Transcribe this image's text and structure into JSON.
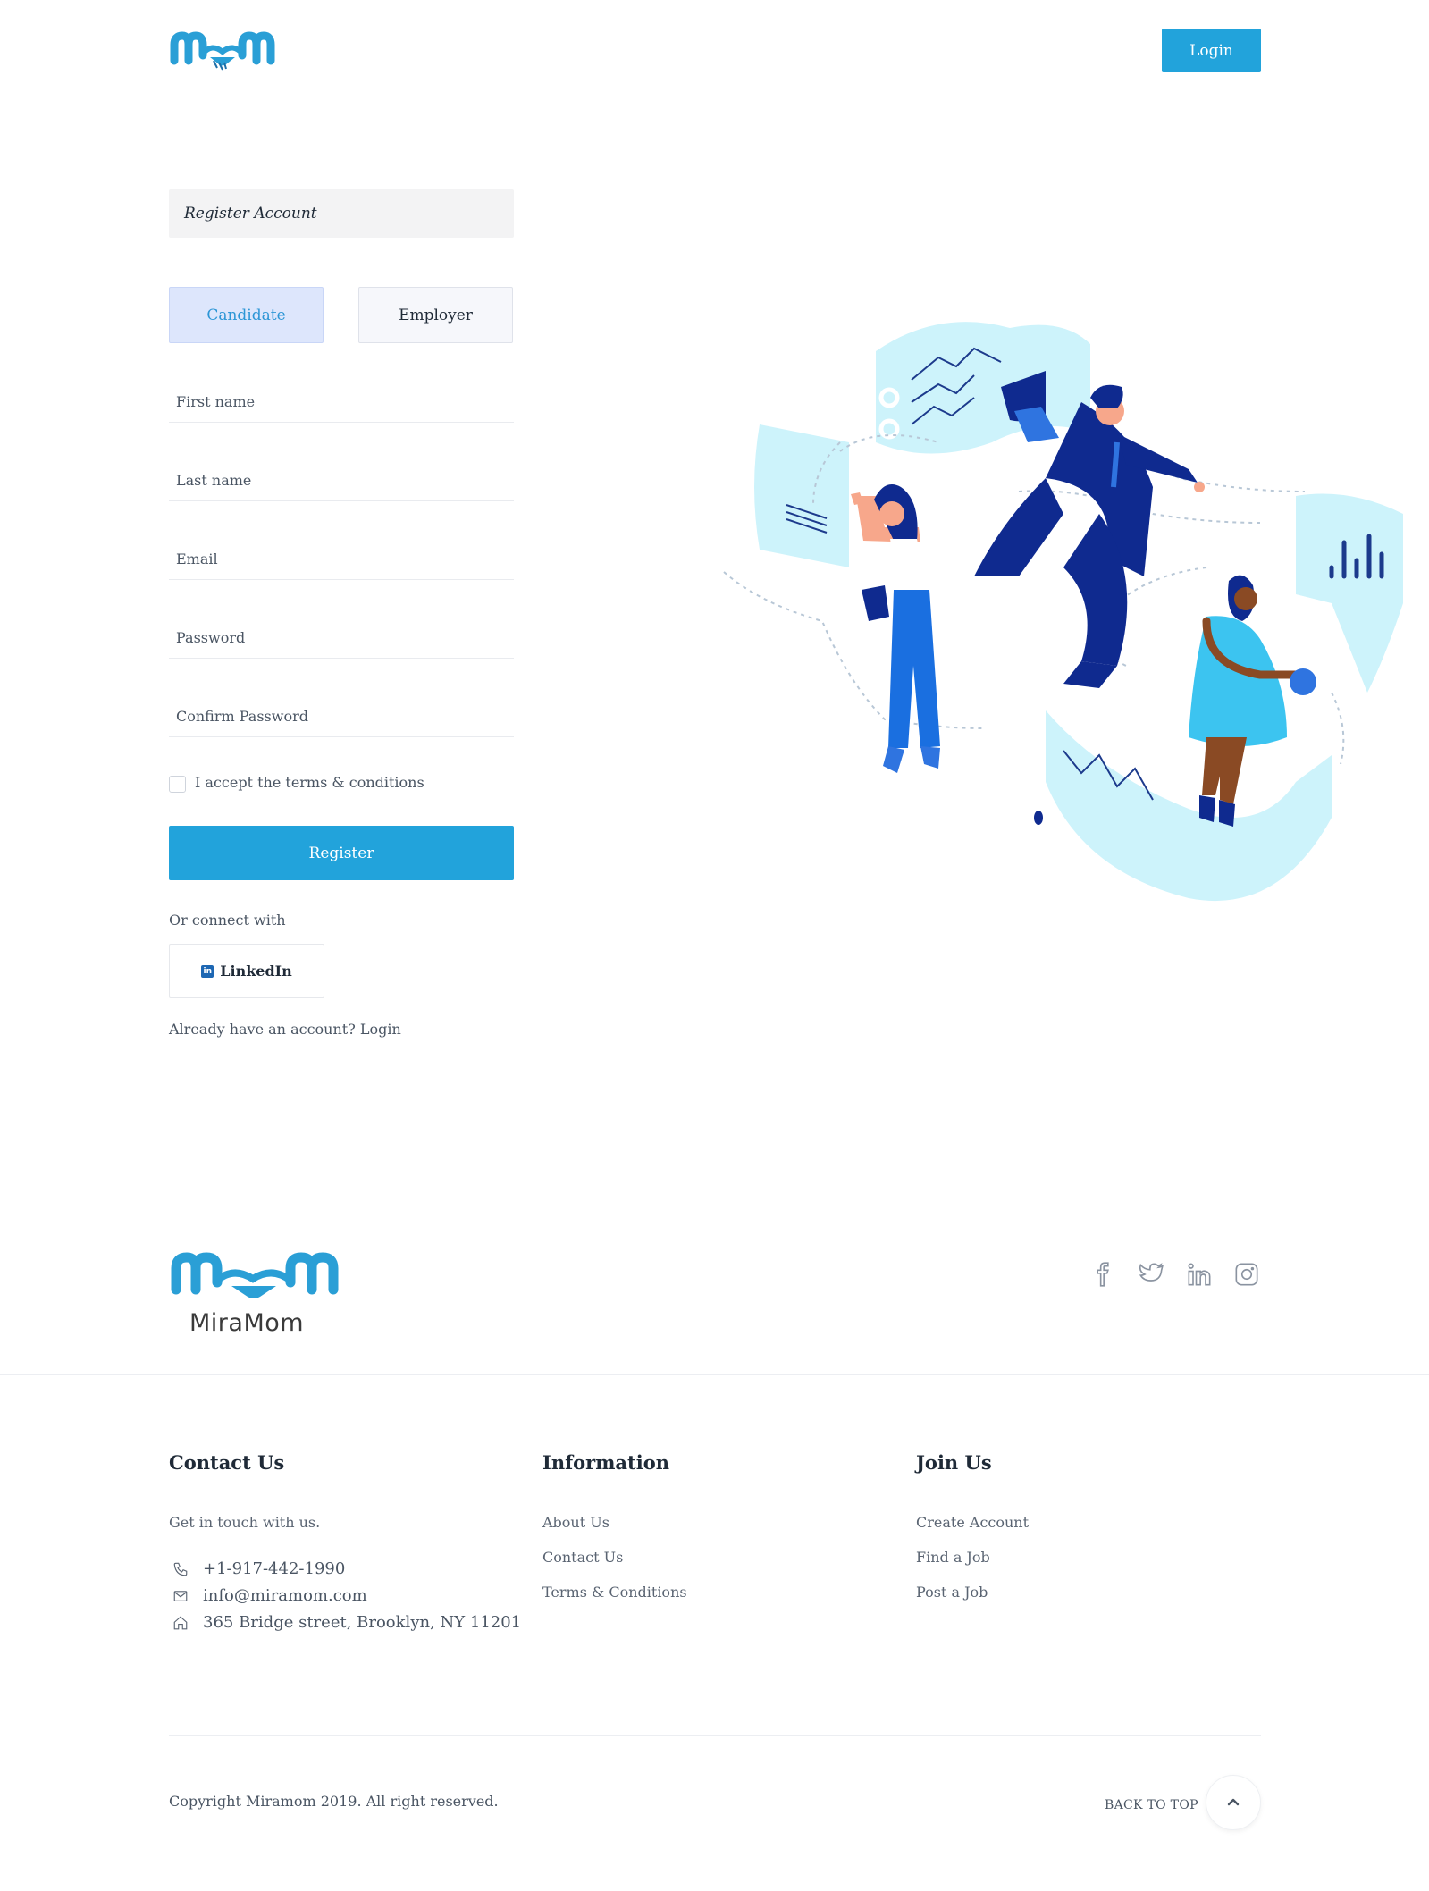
{
  "header": {
    "logo_icon": "miramom-logo-icon",
    "login_label": "Login"
  },
  "form": {
    "title": "Register Account",
    "roles": [
      {
        "label": "Candidate",
        "selected": true
      },
      {
        "label": "Employer",
        "selected": false
      }
    ],
    "fields": {
      "first_name": "First name",
      "last_name": "Last name",
      "email": "Email",
      "password": "Password",
      "confirm_password": "Confirm Password"
    },
    "terms_label": "I accept the terms & conditions",
    "register_label": "Register",
    "connect_text": "Or connect with",
    "linkedin_label": "LinkedIn",
    "already_text": "Already have an account?",
    "already_link": "Login"
  },
  "footer": {
    "brand_name": "MiraMom",
    "social": [
      "facebook-icon",
      "twitter-icon",
      "linkedin-icon",
      "instagram-icon"
    ],
    "contact": {
      "title": "Contact Us",
      "subtitle": "Get in touch with us.",
      "phone": "+1-917-442-1990",
      "email": "info@miramom.com",
      "address": "365 Bridge street, Brooklyn, NY 11201"
    },
    "information": {
      "title": "Information",
      "links": [
        "About Us",
        "Contact Us",
        "Terms & Conditions"
      ]
    },
    "join": {
      "title": "Join Us",
      "links": [
        "Create Account",
        "Find a Job",
        "Post a Job"
      ]
    },
    "copyright": "Copyright Miramom 2019. All right reserved.",
    "back_to_top": "BACK TO TOP"
  },
  "colors": {
    "accent": "#22a3db",
    "candidate_bg": "#dde6fc",
    "illustration_light": "#cdf3fb",
    "illustration_dark": "#0f2a8f"
  }
}
